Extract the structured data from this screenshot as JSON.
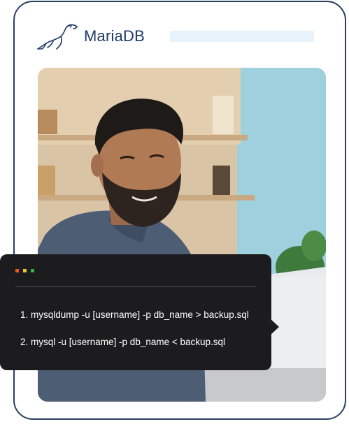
{
  "brand": {
    "name": "MariaDB",
    "logo_icon": "seal-logo-icon",
    "text_color": "#1f3a68"
  },
  "header": {
    "search_bar_color": "#e8f2fb"
  },
  "photo": {
    "subject": "person-using-laptop-photo"
  },
  "terminal": {
    "dots": [
      {
        "name": "red-dot",
        "color": "#e4572e"
      },
      {
        "name": "yellow-dot",
        "color": "#f2c02c"
      },
      {
        "name": "green-dot",
        "color": "#2fb54a"
      }
    ],
    "commands": [
      "1. mysqldump -u [username] -p db_name > backup.sql",
      "2. mysql -u [username] -p db_name < backup.sql"
    ]
  }
}
